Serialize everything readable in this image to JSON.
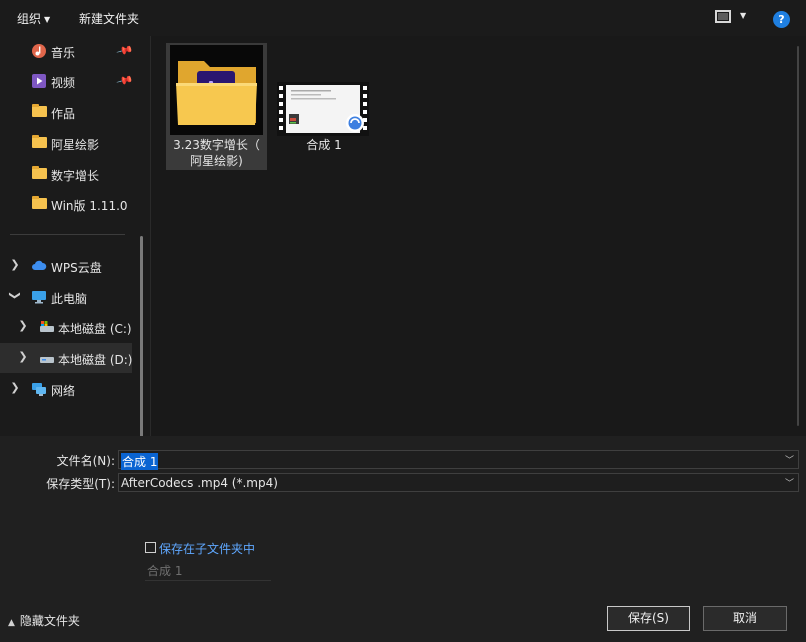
{
  "toolbar": {
    "organize_label": "组织",
    "new_folder_label": "新建文件夹",
    "help_label": "?"
  },
  "nav": {
    "items": [
      {
        "label": "音乐"
      },
      {
        "label": "视频"
      },
      {
        "label": "作品"
      },
      {
        "label": "阿星绘影"
      },
      {
        "label": "数字增长"
      },
      {
        "label": "Win版 1.11.0"
      },
      {
        "label": "WPS云盘"
      },
      {
        "label": "此电脑"
      },
      {
        "label": "本地磁盘 (C:)"
      },
      {
        "label": "本地磁盘 (D:)"
      },
      {
        "label": "网络"
      }
    ]
  },
  "files": [
    {
      "name_line1": "3.23数字增长（",
      "name_line2": "阿星绘影)",
      "thumb_text": "Ae"
    },
    {
      "name_line1": "合成 1"
    }
  ],
  "form": {
    "filename_label": "文件名(N):",
    "filename_value": "合成 1",
    "filetype_label": "保存类型(T):",
    "filetype_value": "AfterCodecs .mp4 (*.mp4)",
    "subfolder_label": "保存在子文件夹中",
    "subfolder_value": "合成 1"
  },
  "hide_folders_label": "隐藏文件夹",
  "buttons": {
    "save": "保存(S)",
    "cancel": "取消"
  },
  "colors": {
    "accent": "#0a64d2",
    "link": "#5fa8ff",
    "folder": "#f6c24e",
    "ae_purple": "#2a1670"
  }
}
